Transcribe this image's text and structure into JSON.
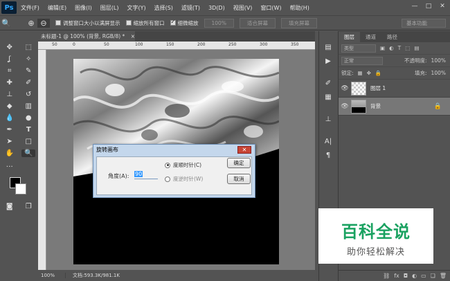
{
  "app": {
    "logo": "Ps"
  },
  "menu": [
    "文件(F)",
    "编辑(E)",
    "图像(I)",
    "图层(L)",
    "文字(Y)",
    "选择(S)",
    "滤镜(T)",
    "3D(D)",
    "视图(V)",
    "窗口(W)",
    "帮助(H)"
  ],
  "window_controls": [
    "—",
    "□",
    "✕"
  ],
  "options": {
    "fit_windows": "调整窗口大小以满屏显示",
    "zoom_all": "缩放所有窗口",
    "scrubby": "细微缩放",
    "zoom_pct_btn": "100%",
    "fit_screen_btn": "适合屏幕",
    "fill_screen_btn": "填充屏幕",
    "workspace": "基本功能"
  },
  "document": {
    "tab_title": "未标题-1 @ 100% (背景, RGB/8) *",
    "zoom": "100%",
    "doc_info": "文档:593.3K/981.1K"
  },
  "ruler": {
    "labels": [
      "50",
      "0",
      "50",
      "100",
      "150",
      "200",
      "250",
      "300",
      "350"
    ]
  },
  "layers_panel": {
    "tabs": [
      "图层",
      "通道",
      "路径"
    ],
    "kind": "类型",
    "blend_mode": "正常",
    "opacity_label": "不透明度:",
    "opacity": "100%",
    "lock_label": "锁定:",
    "fill_label": "填充:",
    "fill": "100%",
    "layers": [
      {
        "name": "图层 1"
      },
      {
        "name": "背景"
      }
    ]
  },
  "dialog": {
    "title": "旋转画布",
    "angle_label": "角度(A):",
    "angle_value": "90",
    "cw_label": "度顺时针(C)",
    "ccw_label": "度逆时针(W)",
    "ok": "确定",
    "cancel": "取消"
  },
  "watermark": {
    "title": "百科全说",
    "subtitle": "助你轻松解决"
  }
}
